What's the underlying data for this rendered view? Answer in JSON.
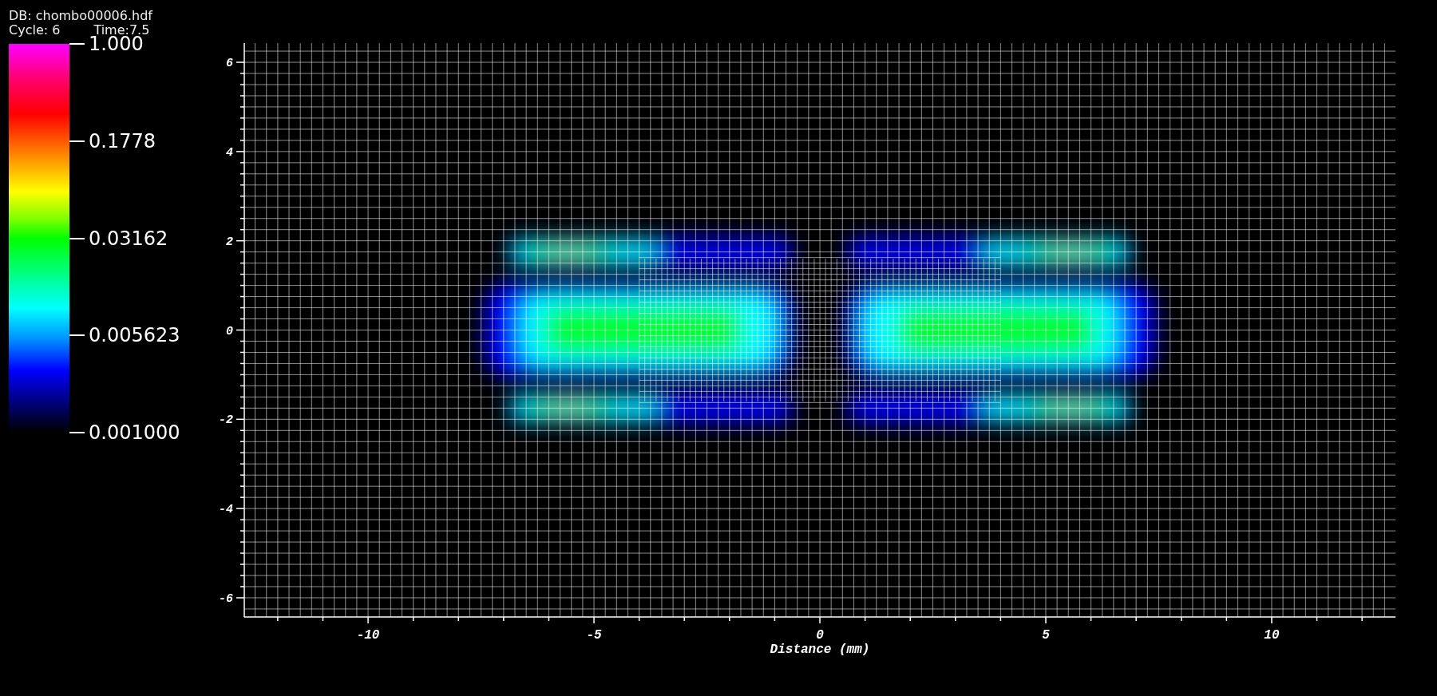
{
  "header": {
    "database": "DB: chombo00006.hdf",
    "cycle": "Cycle: 6",
    "time": "Time:7.5"
  },
  "legend": {
    "labels": [
      "1.000",
      "0.1778",
      "0.03162",
      "0.005623",
      "0.001000"
    ]
  },
  "plot": {
    "xlabel": "Distance (mm)",
    "xticks": [
      "-10",
      "-5",
      "0",
      "5",
      "10"
    ],
    "yticks": [
      "6",
      "4",
      "2",
      "0",
      "-2",
      "-4",
      "-6"
    ]
  }
}
